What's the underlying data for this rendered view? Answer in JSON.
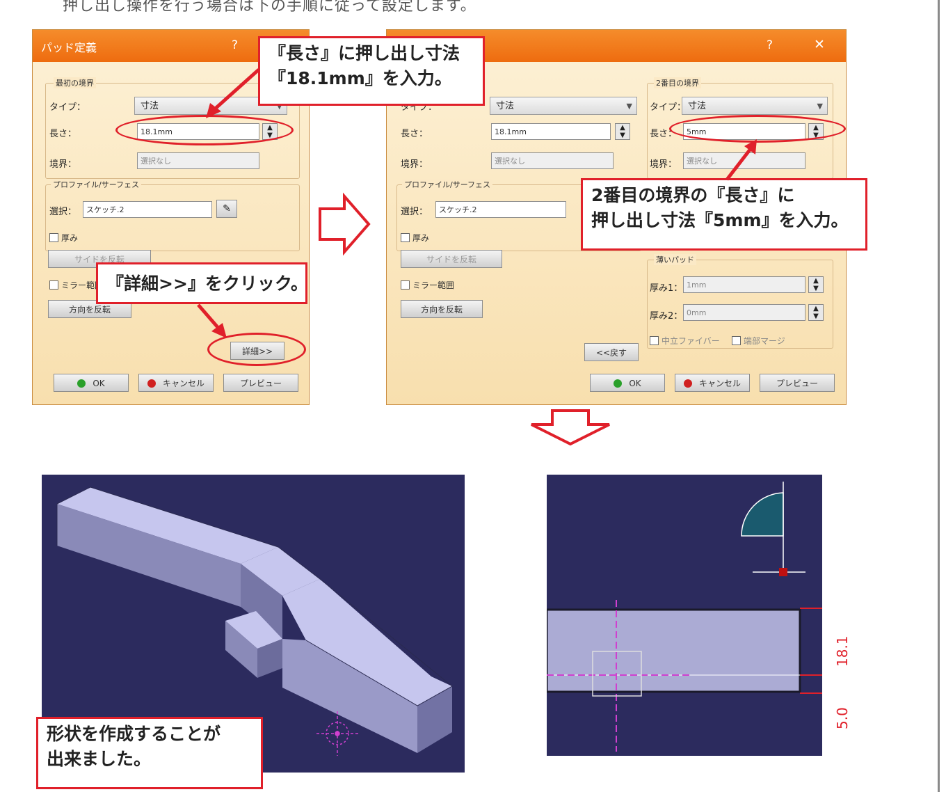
{
  "page": {
    "top_caption": "押し出し操作を行う場合は下の手順に従って設定します。"
  },
  "dialog1": {
    "title": "パッド定義",
    "help_label": "?",
    "first_limit_group": "最初の境界",
    "type_label": "タイプ：",
    "type_value": "寸法",
    "length_label": "長さ：",
    "length_value": "18.1mm",
    "limit_label": "境界：",
    "limit_value": "選択なし",
    "profile_group": "プロファイル/サーフェス",
    "selection_label": "選択：",
    "selection_value": "スケッチ.2",
    "thick_label": "厚み",
    "reverse_side_label": "サイドを反転",
    "mirror_label": "ミラー範囲",
    "reverse_dir_label": "方向を反転",
    "more_label": "詳細>>",
    "ok_label": "OK",
    "cancel_label": "キャンセル",
    "preview_label": "プレビュー"
  },
  "dialog2": {
    "help_label": "?",
    "close_label": "✕",
    "type_label": "タイプ：",
    "type_value": "寸法",
    "length_label": "長さ：",
    "length_value": "18.1mm",
    "limit_label": "境界：",
    "limit_value": "選択なし",
    "profile_group": "プロファイル/サーフェス",
    "selection_label": "選択：",
    "selection_value": "スケッチ.2",
    "thick_label": "厚み",
    "reverse_side_label": "サイドを反転",
    "mirror_label": "ミラー範囲",
    "reverse_dir_label": "方向を反転",
    "second_limit_group": "2番目の境界",
    "type2_label": "タイプ：",
    "type2_value": "寸法",
    "length2_label": "長さ：",
    "length2_value": "5mm",
    "limit2_label": "境界：",
    "limit2_value": "選択なし",
    "thin_group": "薄いパッド",
    "thick1_label": "厚み1：",
    "thick1_value": "1mm",
    "thick2_label": "厚み2：",
    "thick2_value": "0mm",
    "neutral_label": "中立ファイバー",
    "merge_label": "端部マージ",
    "less_label": "<<戻す",
    "ok_label": "OK",
    "cancel_label": "キャンセル",
    "preview_label": "プレビュー"
  },
  "callouts": {
    "length_top_line1": "『長さ』に押し出し寸法",
    "length_top_line2": "『18.1mm』を入力。",
    "second_limit_line1": "2番目の境界の『長さ』に",
    "second_limit_line2": "押し出し寸法『5mm』を入力。",
    "details_click": "『詳細>>』をクリック。",
    "result_line1": "形状を作成することが",
    "result_line2": "出来ました。"
  },
  "dimensions": {
    "dim_upper": "18.1",
    "dim_lower": "5.0"
  },
  "colors": {
    "title_bar": "#ee6c0f",
    "callout_border": "#e0202a",
    "viewport_bg": "#2c2b5e",
    "part_face": "#b8b8e4"
  }
}
